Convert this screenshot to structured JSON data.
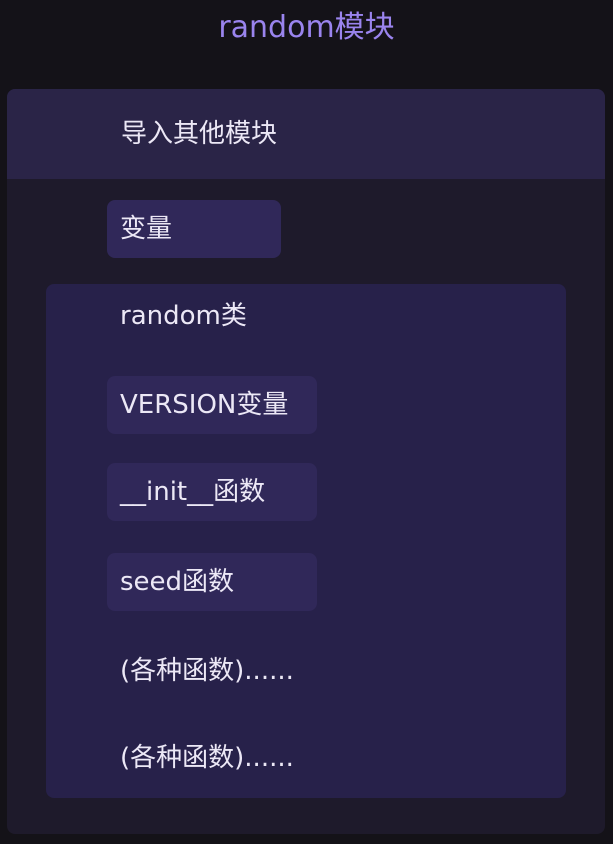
{
  "title": "random模块",
  "module": {
    "header_label": "导入其他模块",
    "variable_label": "变量",
    "class": {
      "label": "random类",
      "items": [
        "VERSION变量",
        "__init__函数",
        "seed函数"
      ],
      "more_items": [
        "(各种函数)......",
        "(各种函数)......"
      ]
    }
  },
  "colors": {
    "background": "#141218",
    "title": "#9a84ee",
    "module_panel": "#1e1a2b",
    "module_header": "#2a2447",
    "class_panel": "#27214a",
    "chip": "#302859",
    "text": "#ece8f6"
  }
}
